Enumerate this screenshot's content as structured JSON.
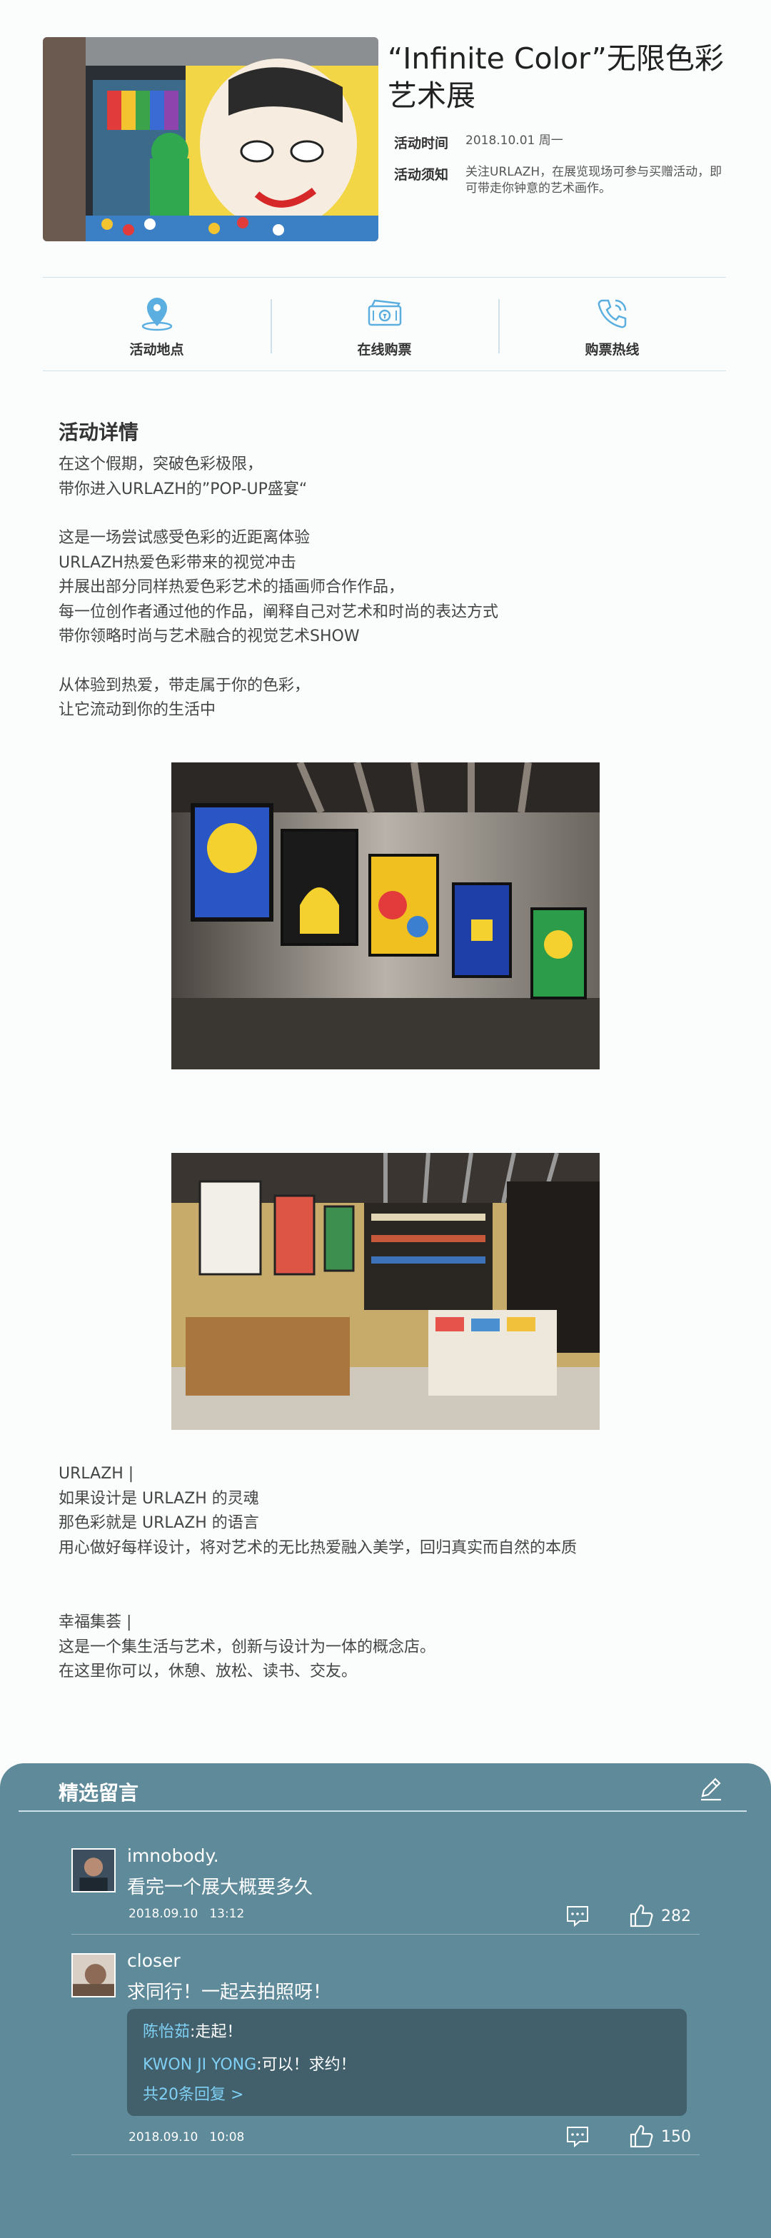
{
  "event": {
    "title": "“Infinite Color”无限色彩艺术展",
    "time_label": "活动时间",
    "time_value": "2018.10.01 周一",
    "notice_label": "活动须知",
    "notice_value": "关注URLAZH，在展览现场可参与买赠活动，即可带走你钟意的艺术画作。"
  },
  "actions": [
    {
      "label": "活动地点",
      "icon": "location-pin-icon"
    },
    {
      "label": "在线购票",
      "icon": "ticket-icon"
    },
    {
      "label": "购票热线",
      "icon": "phone-icon"
    }
  ],
  "details": {
    "heading": "活动详情",
    "para1": [
      "在这个假期，突破色彩极限，",
      "带你进入URLAZH的”POP-UP盛宴“"
    ],
    "para2": [
      "这是一场尝试感受色彩的近距离体验",
      "URLAZH热爱色彩带来的视觉冲击",
      "并展出部分同样热爱色彩艺术的插画师合作作品，",
      "每一位创作者通过他的作品，阐释自己对艺术和时尚的表达方式",
      "带你领略时尚与艺术融合的视觉艺术SHOW"
    ],
    "para3": [
      "从体验到热爱，带走属于你的色彩，",
      "让它流动到你的生活中"
    ],
    "urlazh": [
      "URLAZH |",
      "如果设计是 URLAZH 的灵魂",
      "那色彩就是 URLAZH 的语言",
      "用心做好每样设计，将对艺术的无比热爱融入美学，回归真实而自然的本质"
    ],
    "xingfu": [
      "幸福集荟 |",
      "这是一个集生活与艺术，创新与设计为一体的概念店。",
      "在这里你可以，休憩、放松、读书、交友。"
    ]
  },
  "comments": {
    "heading": "精选留言",
    "items": [
      {
        "name": "imnobody.",
        "text": "看完一个展大概要多久",
        "date": "2018.09.10",
        "time": "13:12",
        "likes": "282"
      },
      {
        "name": "closer",
        "text": "求同行！一起去拍照呀！",
        "date": "2018.09.10",
        "time": "10:08",
        "likes": "150",
        "replies": [
          {
            "who": "陈怡茹",
            "text": ":走起！"
          },
          {
            "who": "KWON JI YONG",
            "text": ":可以！求约！"
          }
        ],
        "more_replies": "共20条回复 >"
      }
    ]
  },
  "colors": {
    "accent": "#5aaee0",
    "comment_bg": "#5e8a99",
    "reply_bg": "#42606c",
    "reply_name": "#7fd0f4"
  }
}
